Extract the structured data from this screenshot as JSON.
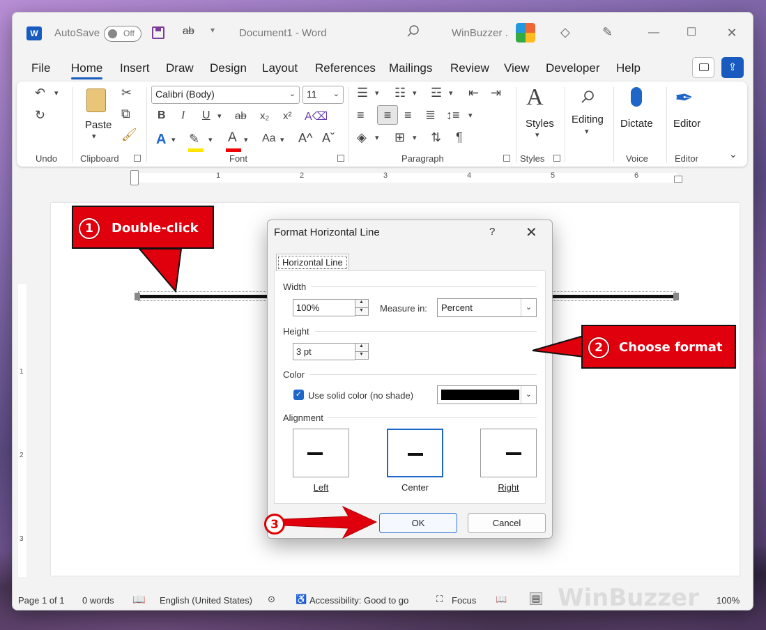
{
  "window": {
    "app_logo": "W",
    "autosave_label": "AutoSave",
    "autosave_state": "Off",
    "doc_title": "Document1  -  Word",
    "user_name": "WinBuzzer ."
  },
  "menu": {
    "tabs": [
      "File",
      "Home",
      "Insert",
      "Draw",
      "Design",
      "Layout",
      "References",
      "Mailings",
      "Review",
      "View",
      "Developer",
      "Help"
    ],
    "active": "Home"
  },
  "ribbon": {
    "groups": {
      "undo": "Undo",
      "clipboard": "Clipboard",
      "font": "Font",
      "paragraph": "Paragraph",
      "styles": "Styles",
      "voice": "Voice",
      "editor": "Editor"
    },
    "paste_label": "Paste",
    "font_name": "Calibri (Body)",
    "font_size": "11",
    "styles_label": "Styles",
    "editing_label": "Editing",
    "dictate_label": "Dictate",
    "editor_label": "Editor",
    "font_buttons": {
      "bold": "B",
      "italic": "I",
      "underline": "U",
      "strike": "ab",
      "sub": "x₂",
      "sup": "x²",
      "effects": "A",
      "font_color": "A",
      "change_case": "Aa",
      "grow": "A^",
      "shrink": "Aˇ"
    }
  },
  "ruler": {
    "h_numbers": [
      "1",
      "2",
      "3",
      "4",
      "5",
      "6"
    ],
    "v_numbers": [
      "1",
      "2",
      "3"
    ]
  },
  "status": {
    "page": "Page 1 of 1",
    "words": "0 words",
    "language": "English (United States)",
    "accessibility": "Accessibility: Good to go",
    "focus": "Focus",
    "zoom": "100%"
  },
  "dialog": {
    "title": "Format Horizontal Line",
    "help": "?",
    "tab": "Horizontal Line",
    "width_section": "Width",
    "width_value": "100%",
    "measure_label": "Measure in:",
    "measure_value": "Percent",
    "height_section": "Height",
    "height_value": "3 pt",
    "color_section": "Color",
    "solid_color_label": "Use solid color (no shade)",
    "solid_color_checked": true,
    "line_color": "#000000",
    "alignment_section": "Alignment",
    "alignments": [
      "Left",
      "Center",
      "Right"
    ],
    "selected_alignment": "Center",
    "ok": "OK",
    "cancel": "Cancel"
  },
  "callouts": {
    "step1": {
      "num": "1",
      "text": "Double-click"
    },
    "step2": {
      "num": "2",
      "text": "Choose format"
    },
    "step3": {
      "num": "3"
    }
  },
  "watermark": "WinBuzzer",
  "colors": {
    "accent": "#185abd",
    "callout_red": "#e0000d"
  }
}
